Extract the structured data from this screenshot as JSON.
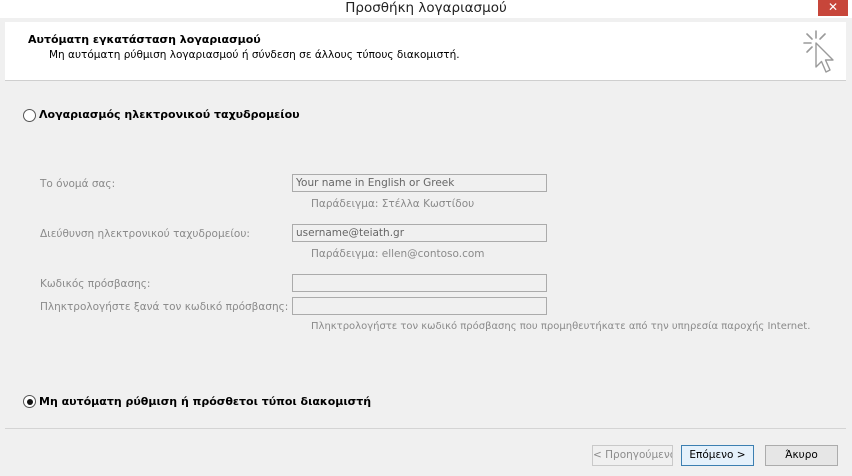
{
  "window": {
    "title": "Προσθήκη λογαριασμού",
    "close_label": "✕"
  },
  "header": {
    "title": "Αυτόματη εγκατάσταση λογαριασμού",
    "subtitle": "Μη αυτόματη ρύθμιση λογαριασμού ή σύνδεση σε άλλους τύπους διακομιστή.",
    "icon": "cursor-click-icon"
  },
  "options": {
    "email_account": {
      "label": "Λογαριασμός ηλεκτρονικού ταχυδρομείου",
      "selected": false
    },
    "manual_setup": {
      "label": "Μη αυτόματη ρύθμιση ή πρόσθετοι τύποι διακομιστή",
      "selected": true
    }
  },
  "form": {
    "name": {
      "label": "Το όνομά σας:",
      "value": "Your name in English or Greek",
      "hint": "Παράδειγμα: Στέλλα Κωστίδου"
    },
    "email": {
      "label": "Διεύθυνση ηλεκτρονικού ταχυδρομείου:",
      "value": "username@teiath.gr",
      "hint": "Παράδειγμα: ellen@contoso.com"
    },
    "password": {
      "label": "Κωδικός πρόσβασης:",
      "value": ""
    },
    "password_confirm": {
      "label": "Πληκτρολογήστε ξανά τον κωδικό πρόσβασης:",
      "value": ""
    },
    "password_hint": "Πληκτρολογήστε τον κωδικό πρόσβασης που προμηθευτήκατε από την υπηρεσία παροχής Internet."
  },
  "buttons": {
    "back": "< Προηγούμενο",
    "next": "Επόμενο >",
    "cancel": "Άκυρο"
  },
  "colors": {
    "close_button": "#c7463a",
    "primary_button_border": "#3c7fb1",
    "disabled_text": "#8a8a8a"
  }
}
